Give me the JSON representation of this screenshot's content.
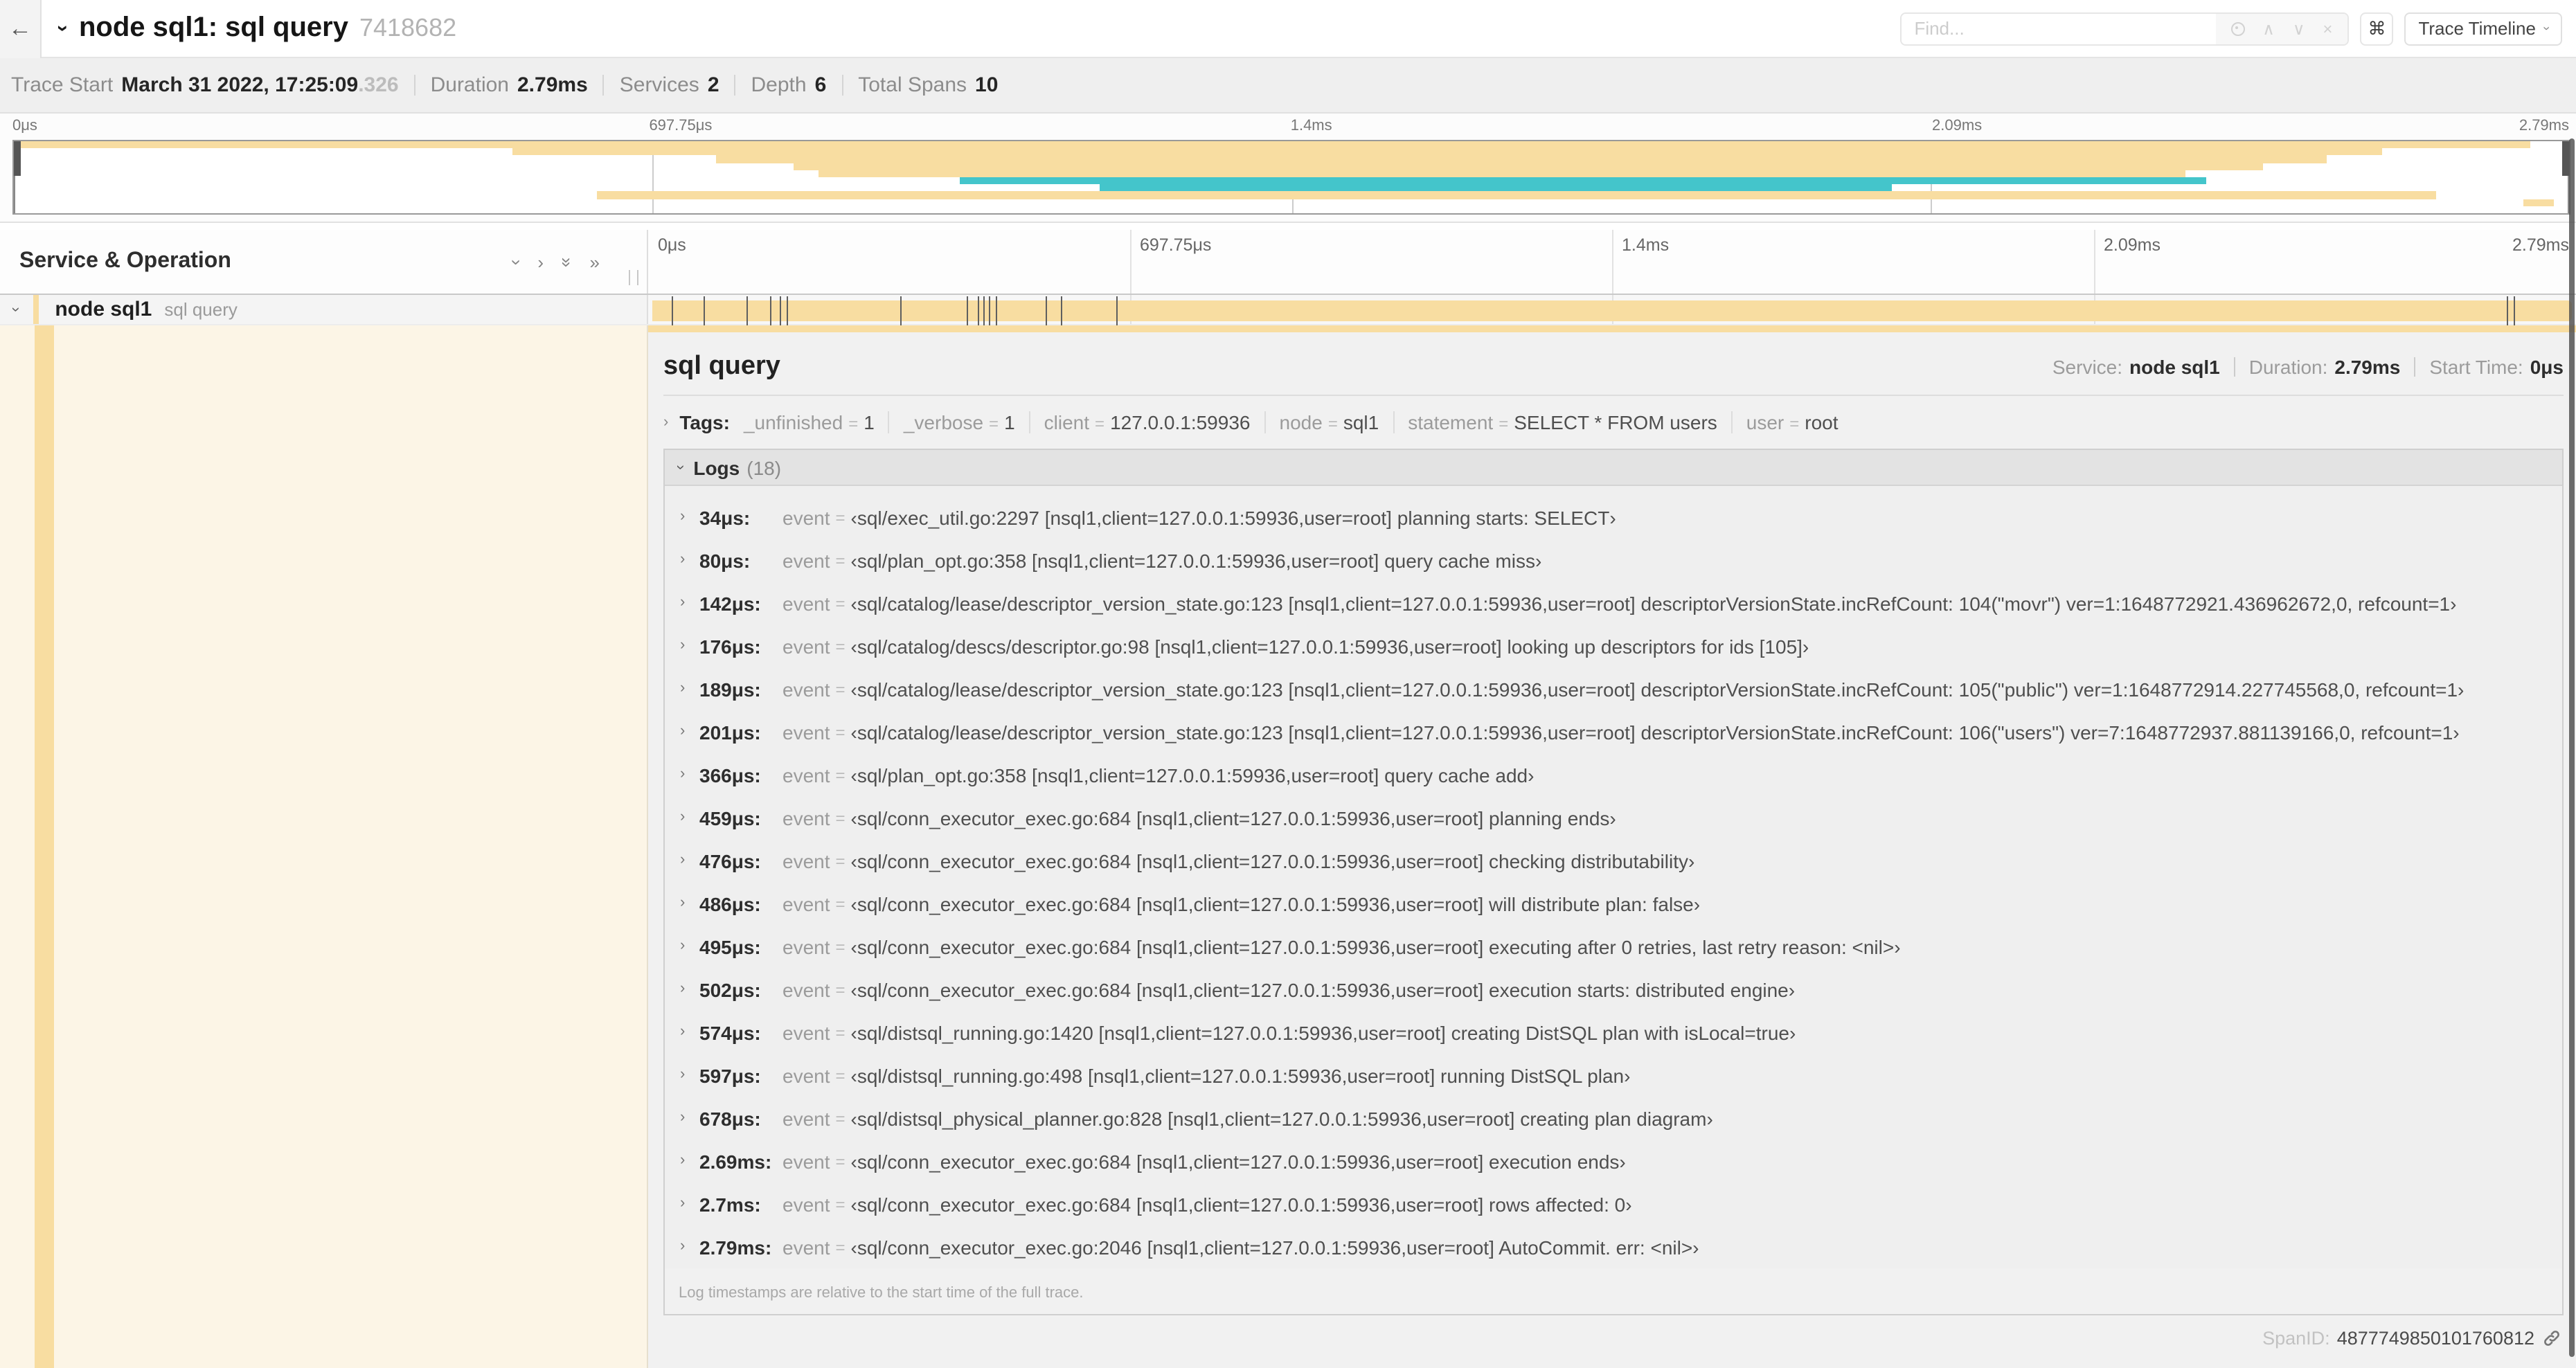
{
  "icons": {
    "back": "←",
    "command": "⌘",
    "chevron": "›",
    "double_chevron": "»",
    "up": "∧",
    "down": "∨",
    "close": "×"
  },
  "header": {
    "title": "node sql1: sql query",
    "trace_id": "7418682",
    "find_placeholder": "Find...",
    "view_selector": "Trace Timeline"
  },
  "summary": {
    "items": [
      {
        "label": "Trace Start",
        "value": "March 31 2022, 17:25:09",
        "suffix": ".326"
      },
      {
        "label": "Duration",
        "value": "2.79ms",
        "suffix": ""
      },
      {
        "label": "Services",
        "value": "2",
        "suffix": ""
      },
      {
        "label": "Depth",
        "value": "6",
        "suffix": ""
      },
      {
        "label": "Total Spans",
        "value": "10",
        "suffix": ""
      }
    ]
  },
  "minimap": {
    "ticks": [
      "0μs",
      "697.75μs",
      "1.4ms",
      "2.09ms",
      "2.79ms"
    ],
    "palette": {
      "span": "#F8DDA1",
      "remote": "#44C5CB"
    },
    "bars": [
      {
        "row": 0,
        "c": "span",
        "s": 0,
        "e": 98.5
      },
      {
        "row": 1,
        "c": "span",
        "s": 19.5,
        "e": 92.7
      },
      {
        "row": 2,
        "c": "span",
        "s": 27.5,
        "e": 90.5
      },
      {
        "row": 3,
        "c": "span",
        "s": 30.5,
        "e": 88
      },
      {
        "row": 4,
        "c": "span",
        "s": 31.5,
        "e": 85
      },
      {
        "row": 5,
        "c": "remote",
        "s": 37,
        "e": 85.8
      },
      {
        "row": 6,
        "c": "remote",
        "s": 42.5,
        "e": 73.5
      },
      {
        "row": 7,
        "c": "span",
        "s": 22.8,
        "e": 94.8
      },
      {
        "row": 8,
        "c": "span",
        "s": 98.2,
        "e": 99.4
      }
    ]
  },
  "timeline": {
    "left_header": "Service & Operation",
    "ruler": [
      "0μs",
      "697.75μs",
      "1.4ms",
      "2.09ms",
      "2.79ms"
    ]
  },
  "span_row": {
    "service": "node sql1",
    "operation": "sql query",
    "bar_color": "#F8DDA1",
    "tick_pcts": [
      1.2,
      2.9,
      5.1,
      6.3,
      6.8,
      7.2,
      13.1,
      16.5,
      17.1,
      17.4,
      17.7,
      18.0,
      20.6,
      21.4,
      24.3,
      96.4,
      96.8
    ]
  },
  "detail": {
    "title": "sql query",
    "meta": [
      {
        "label": "Service:",
        "value": "node sql1"
      },
      {
        "label": "Duration:",
        "value": "2.79ms"
      },
      {
        "label": "Start Time:",
        "value": "0μs"
      }
    ],
    "tags": {
      "label": "Tags:",
      "eq": "=",
      "pairs": [
        {
          "k": "_unfinished",
          "v": "1"
        },
        {
          "k": "_verbose",
          "v": "1"
        },
        {
          "k": "client",
          "v": "127.0.0.1:59936"
        },
        {
          "k": "node",
          "v": "sql1"
        },
        {
          "k": "statement",
          "v": "SELECT * FROM users"
        },
        {
          "k": "user",
          "v": "root"
        }
      ]
    },
    "logs": {
      "label": "Logs",
      "count": "(18)",
      "key": "event",
      "eq": "=",
      "entries": [
        {
          "time": "34μs:",
          "value": "‹sql/exec_util.go:2297 [nsql1,client=127.0.0.1:59936,user=root] planning starts: SELECT›"
        },
        {
          "time": "80μs:",
          "value": "‹sql/plan_opt.go:358 [nsql1,client=127.0.0.1:59936,user=root] query cache miss›"
        },
        {
          "time": "142μs:",
          "value": "‹sql/catalog/lease/descriptor_version_state.go:123 [nsql1,client=127.0.0.1:59936,user=root] descriptorVersionState.incRefCount: 104(\"movr\") ver=1:1648772921.436962672,0, refcount=1›"
        },
        {
          "time": "176μs:",
          "value": "‹sql/catalog/descs/descriptor.go:98 [nsql1,client=127.0.0.1:59936,user=root] looking up descriptors for ids [105]›"
        },
        {
          "time": "189μs:",
          "value": "‹sql/catalog/lease/descriptor_version_state.go:123 [nsql1,client=127.0.0.1:59936,user=root] descriptorVersionState.incRefCount: 105(\"public\") ver=1:1648772914.227745568,0, refcount=1›"
        },
        {
          "time": "201μs:",
          "value": "‹sql/catalog/lease/descriptor_version_state.go:123 [nsql1,client=127.0.0.1:59936,user=root] descriptorVersionState.incRefCount: 106(\"users\") ver=7:1648772937.881139166,0, refcount=1›"
        },
        {
          "time": "366μs:",
          "value": "‹sql/plan_opt.go:358 [nsql1,client=127.0.0.1:59936,user=root] query cache add›"
        },
        {
          "time": "459μs:",
          "value": "‹sql/conn_executor_exec.go:684 [nsql1,client=127.0.0.1:59936,user=root] planning ends›"
        },
        {
          "time": "476μs:",
          "value": "‹sql/conn_executor_exec.go:684 [nsql1,client=127.0.0.1:59936,user=root] checking distributability›"
        },
        {
          "time": "486μs:",
          "value": "‹sql/conn_executor_exec.go:684 [nsql1,client=127.0.0.1:59936,user=root] will distribute plan: false›"
        },
        {
          "time": "495μs:",
          "value": "‹sql/conn_executor_exec.go:684 [nsql1,client=127.0.0.1:59936,user=root] executing after 0 retries, last retry reason: <nil>›"
        },
        {
          "time": "502μs:",
          "value": "‹sql/conn_executor_exec.go:684 [nsql1,client=127.0.0.1:59936,user=root] execution starts: distributed engine›"
        },
        {
          "time": "574μs:",
          "value": "‹sql/distsql_running.go:1420 [nsql1,client=127.0.0.1:59936,user=root] creating DistSQL plan with isLocal=true›"
        },
        {
          "time": "597μs:",
          "value": "‹sql/distsql_running.go:498 [nsql1,client=127.0.0.1:59936,user=root] running DistSQL plan›"
        },
        {
          "time": "678μs:",
          "value": "‹sql/distsql_physical_planner.go:828 [nsql1,client=127.0.0.1:59936,user=root] creating plan diagram›"
        },
        {
          "time": "2.69ms:",
          "value": "‹sql/conn_executor_exec.go:684 [nsql1,client=127.0.0.1:59936,user=root] execution ends›"
        },
        {
          "time": "2.7ms:",
          "value": "‹sql/conn_executor_exec.go:684 [nsql1,client=127.0.0.1:59936,user=root] rows affected: 0›"
        },
        {
          "time": "2.79ms:",
          "value": "‹sql/conn_executor_exec.go:2046 [nsql1,client=127.0.0.1:59936,user=root] AutoCommit. err: <nil>›"
        }
      ],
      "footnote": "Log timestamps are relative to the start time of the full trace."
    },
    "span_id": {
      "label": "SpanID:",
      "value": "4877749850101760812"
    }
  }
}
